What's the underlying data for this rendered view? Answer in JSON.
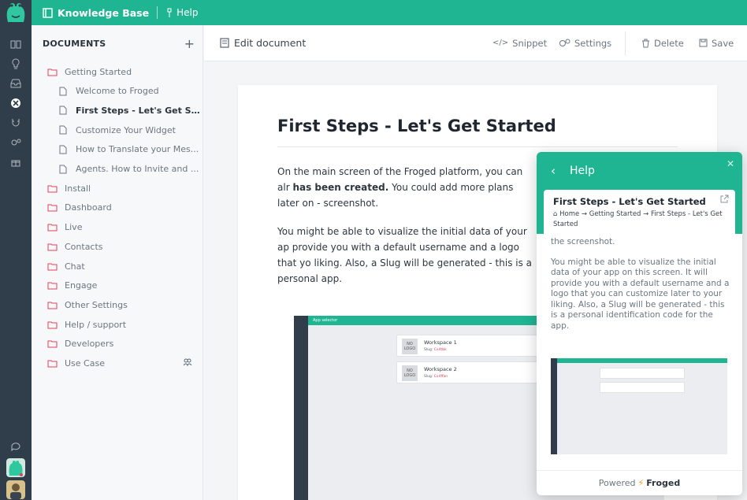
{
  "topbar": {
    "app_title": "Knowledge Base",
    "help_label": "Help"
  },
  "docs": {
    "header": "DOCUMENTS",
    "add_icon": "plus-icon",
    "items": [
      {
        "type": "folder-open",
        "label": "Getting Started"
      },
      {
        "type": "doc",
        "label": "Welcome to Froged"
      },
      {
        "type": "doc",
        "label": "First Steps - Let's Get Sta...",
        "selected": true
      },
      {
        "type": "doc",
        "label": "Customize Your Widget"
      },
      {
        "type": "doc",
        "label": " How to Translate your Mes..."
      },
      {
        "type": "doc",
        "label": "Agents. How to Invite and ..."
      },
      {
        "type": "folder",
        "label": "Install"
      },
      {
        "type": "folder",
        "label": "Dashboard"
      },
      {
        "type": "folder",
        "label": "Live"
      },
      {
        "type": "folder",
        "label": "Contacts"
      },
      {
        "type": "folder",
        "label": "Chat"
      },
      {
        "type": "folder",
        "label": "Engage"
      },
      {
        "type": "folder",
        "label": "Other Settings"
      },
      {
        "type": "folder",
        "label": "Help / support"
      },
      {
        "type": "folder",
        "label": "Developers"
      },
      {
        "type": "folder",
        "label": "Use Case",
        "extra_icon": "users-icon"
      }
    ]
  },
  "toolbar": {
    "edit_label": "Edit document",
    "snippet_label": "Snippet",
    "settings_label": "Settings",
    "delete_label": "Delete",
    "save_label": "Save"
  },
  "document": {
    "title": "First Steps - Let's Get Started",
    "p1_a": "On the main screen of the Froged platform, you can alr",
    "p1_b": "has been created.",
    "p1_c": " You could add more plans later on -",
    "p1_d": "screenshot.",
    "p2": "You might be able to visualize the initial data of your ap provide you with a default username and a logo that yo liking. Also, a Slug will be generated -  this is a personal app.",
    "screenshot": {
      "top_label": "App selector",
      "workspaces": [
        {
          "logo": "NO LOGO",
          "name": "Workspace 1",
          "slug_label": "Slug:",
          "slug": "Cx4tbk"
        },
        {
          "logo": "NO LOGO",
          "name": "Workspace 2",
          "slug_label": "Slug:",
          "slug": "Cx4ffan"
        }
      ]
    }
  },
  "widget": {
    "title": "Help",
    "article_title": "First Steps - Let's Get Started",
    "breadcrumb": "Home → Getting Started → First Steps - Let's Get Started",
    "body_top": "the screenshot.",
    "body": "You might be able to visualize the initial data of your app on this screen. It will provide you with a default username and a logo that you can customize later to your liking. Also, a Slug will be generated -  this is a personal identification code for the app.",
    "footer_powered": "Powered",
    "footer_brand": "Froged"
  },
  "colors": {
    "brand": "#1fb592",
    "rail": "#2f3e4a",
    "accent_slug": "#e2405a",
    "bolt": "#f59c1a"
  }
}
